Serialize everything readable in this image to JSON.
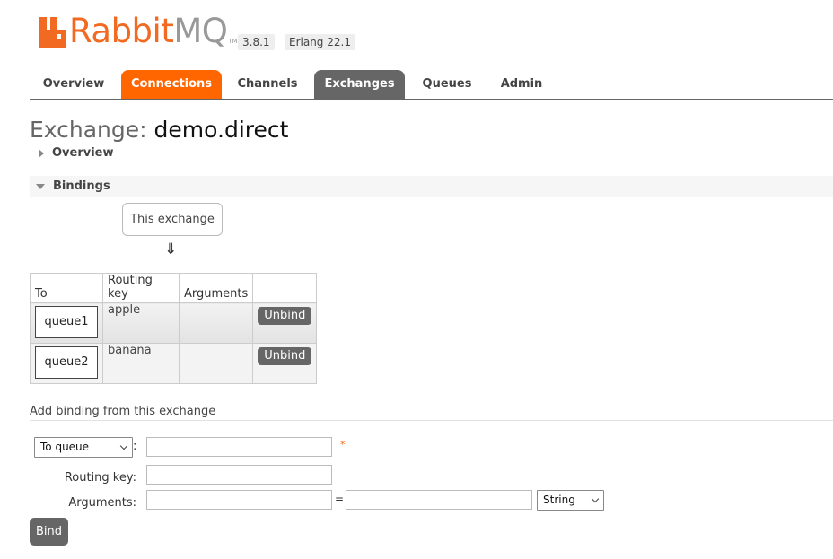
{
  "header": {
    "brand_primary": "Rabbit",
    "brand_secondary": "MQ",
    "trademark": "TM",
    "version": "3.8.1",
    "erlang": "Erlang 22.1",
    "brand_color": "#f26a21"
  },
  "tabs": [
    {
      "label": "Overview",
      "active": false
    },
    {
      "label": "Connections",
      "active": false,
      "highlight": "#ff6600"
    },
    {
      "label": "Channels",
      "active": false
    },
    {
      "label": "Exchanges",
      "active": true
    },
    {
      "label": "Queues",
      "active": false
    },
    {
      "label": "Admin",
      "active": false
    }
  ],
  "page": {
    "title_prefix": "Exchange:",
    "exchange_name": "demo.direct"
  },
  "sections": {
    "overview": "Overview",
    "bindings": "Bindings"
  },
  "bindings": {
    "source_label": "This exchange",
    "arrow": "⇓",
    "columns": [
      "To",
      "Routing key",
      "Arguments",
      ""
    ],
    "rows": [
      {
        "to": "queue1",
        "routing_key": "apple",
        "arguments": "",
        "action": "Unbind"
      },
      {
        "to": "queue2",
        "routing_key": "banana",
        "arguments": "",
        "action": "Unbind"
      }
    ]
  },
  "add_binding": {
    "heading": "Add binding from this exchange",
    "destination_type": "To queue",
    "colon": ":",
    "required_mark": "*",
    "destination_value": "",
    "routing_key_label": "Routing key:",
    "routing_key_value": "",
    "arguments_label": "Arguments:",
    "arg_key_value": "",
    "equals": "=",
    "arg_value_value": "",
    "arg_type": "String",
    "submit_label": "Bind"
  }
}
